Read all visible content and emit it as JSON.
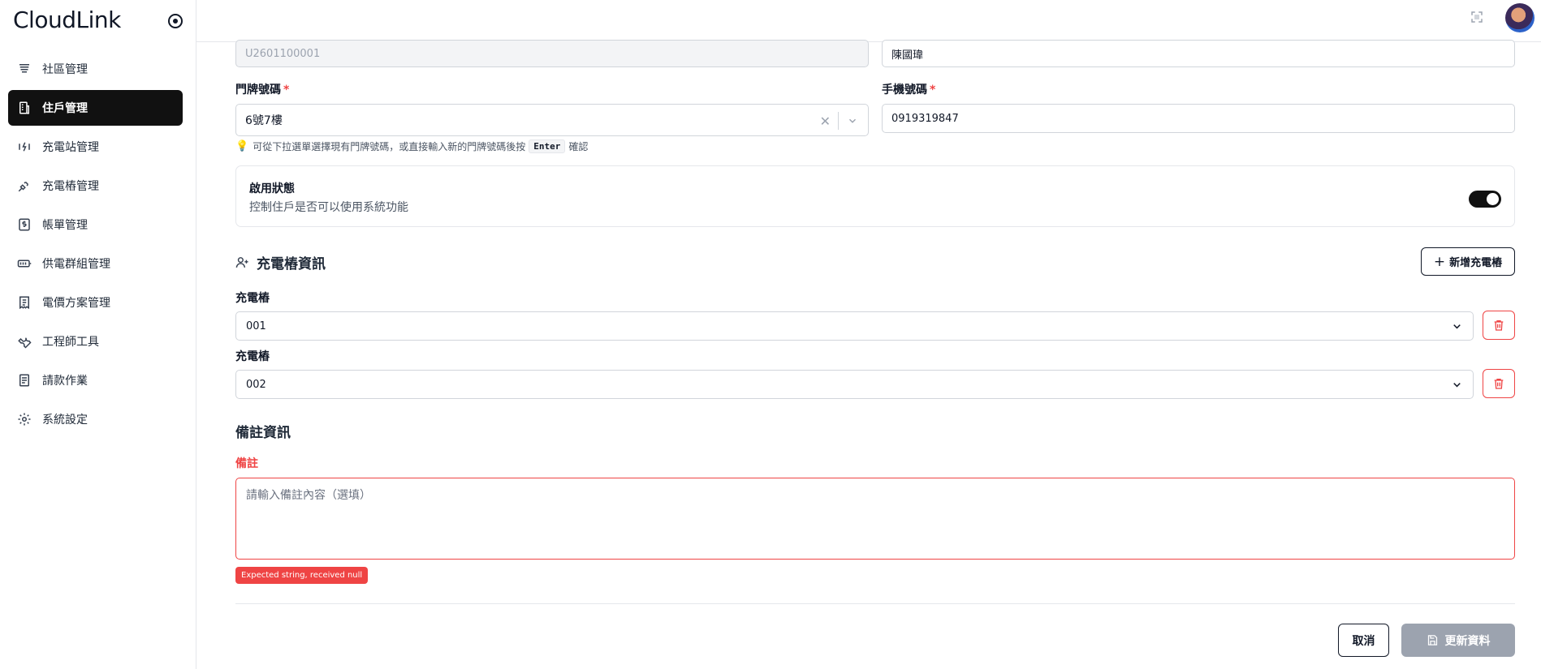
{
  "brand": {
    "logo_text": "CloudLink"
  },
  "sidebar": {
    "items": [
      {
        "label": "社區管理",
        "icon": "building-icon"
      },
      {
        "label": "住戶管理",
        "icon": "resident-icon",
        "active": true
      },
      {
        "label": "充電站管理",
        "icon": "charging-station-icon"
      },
      {
        "label": "充電樁管理",
        "icon": "plug-icon"
      },
      {
        "label": "帳單管理",
        "icon": "bill-icon"
      },
      {
        "label": "供電群組管理",
        "icon": "battery-icon"
      },
      {
        "label": "電價方案管理",
        "icon": "receipt-icon"
      },
      {
        "label": "工程師工具",
        "icon": "wrench-icon"
      },
      {
        "label": "請款作業",
        "icon": "document-icon"
      },
      {
        "label": "系統設定",
        "icon": "gear-icon"
      }
    ]
  },
  "form": {
    "resident_id_value": "U2601100001",
    "name_value": "陳國瑋",
    "door_number": {
      "label": "門牌號碼",
      "value": "6號7樓"
    },
    "phone": {
      "label": "手機號碼",
      "value": "0919319847"
    },
    "hint": {
      "before": "可從下拉選單選擇現有門牌號碼，或直接輸入新的門牌號碼後按",
      "key": "Enter",
      "after": "確認"
    },
    "status": {
      "title": "啟用狀態",
      "description": "控制住戶是否可以使用系統功能",
      "enabled": true
    }
  },
  "chargers": {
    "section_title": "充電樁資訊",
    "add_button": "新增充電樁",
    "items": [
      {
        "label": "充電樁",
        "value": "001"
      },
      {
        "label": "充電樁",
        "value": "002"
      }
    ]
  },
  "remarks": {
    "section_title": "備註資訊",
    "label": "備註",
    "placeholder": "請輸入備註內容（選填）",
    "error": "Expected string, received null"
  },
  "actions": {
    "cancel": "取消",
    "update": "更新資料"
  },
  "colors": {
    "accent": "#111111",
    "danger": "#ef4444",
    "disabled": "#9ca3af"
  }
}
